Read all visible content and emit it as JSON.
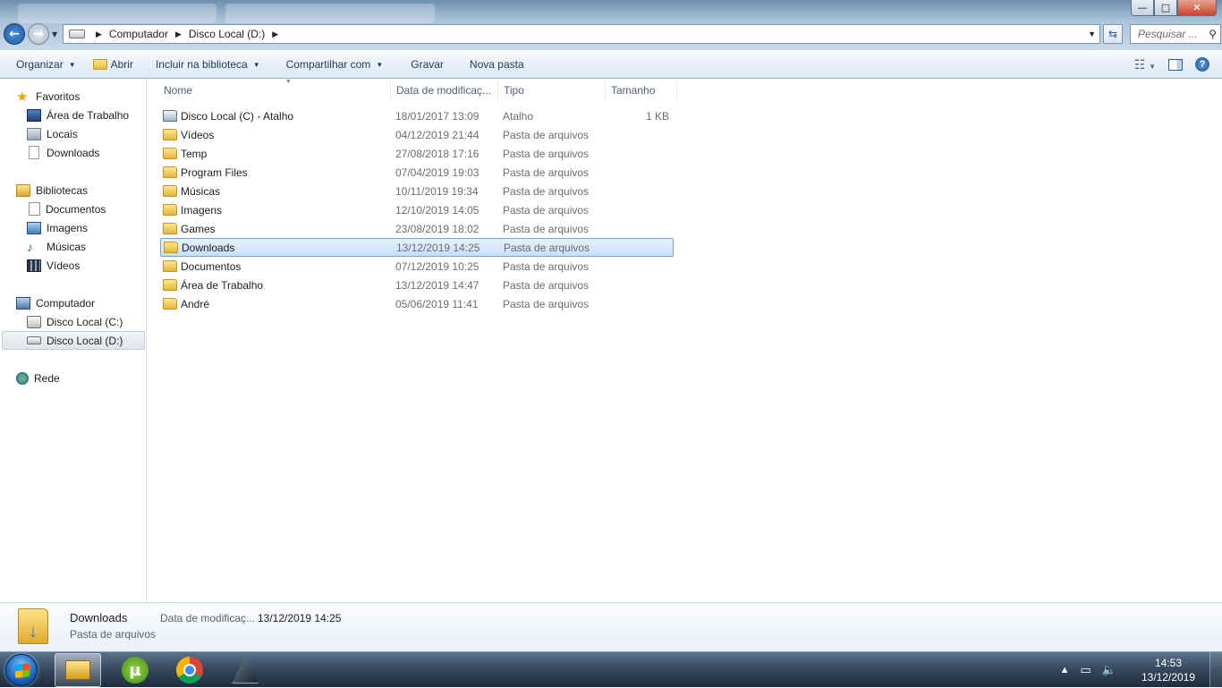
{
  "window": {
    "controls": {
      "minimize": "—",
      "maximize": "□",
      "close": "✕"
    }
  },
  "address": {
    "segments": [
      "Computador",
      "Disco Local (D:)"
    ],
    "search_placeholder": "Pesquisar ..."
  },
  "toolbar": {
    "organize": "Organizar",
    "open": "Abrir",
    "include_library": "Incluir na biblioteca",
    "share": "Compartilhar com",
    "burn": "Gravar",
    "new_folder": "Nova pasta"
  },
  "navpane": {
    "favorites": {
      "label": "Favoritos",
      "items": [
        "Área de Trabalho",
        "Locais",
        "Downloads"
      ]
    },
    "libraries": {
      "label": "Bibliotecas",
      "items": [
        "Documentos",
        "Imagens",
        "Músicas",
        "Vídeos"
      ]
    },
    "computer": {
      "label": "Computador",
      "items": [
        "Disco Local (C:)",
        "Disco Local (D:)"
      ]
    },
    "network": {
      "label": "Rede"
    }
  },
  "columns": [
    "Nome",
    "Data de modificaç...",
    "Tipo",
    "Tamanho"
  ],
  "files": [
    {
      "name": "Disco Local (C) - Atalho",
      "date": "18/01/2017 13:09",
      "type": "Atalho",
      "size": "1 KB"
    },
    {
      "name": "Vídeos",
      "date": "04/12/2019 21:44",
      "type": "Pasta de arquivos",
      "size": ""
    },
    {
      "name": "Temp",
      "date": "27/08/2018 17:16",
      "type": "Pasta de arquivos",
      "size": ""
    },
    {
      "name": "Program Files",
      "date": "07/04/2019 19:03",
      "type": "Pasta de arquivos",
      "size": ""
    },
    {
      "name": "Músicas",
      "date": "10/11/2019 19:34",
      "type": "Pasta de arquivos",
      "size": ""
    },
    {
      "name": "Imagens",
      "date": "12/10/2019 14:05",
      "type": "Pasta de arquivos",
      "size": ""
    },
    {
      "name": "Games",
      "date": "23/08/2019 18:02",
      "type": "Pasta de arquivos",
      "size": ""
    },
    {
      "name": "Downloads",
      "date": "13/12/2019 14:25",
      "type": "Pasta de arquivos",
      "size": ""
    },
    {
      "name": "Documentos",
      "date": "07/12/2019 10:25",
      "type": "Pasta de arquivos",
      "size": ""
    },
    {
      "name": "Área de Trabalho",
      "date": "13/12/2019 14:47",
      "type": "Pasta de arquivos",
      "size": ""
    },
    {
      "name": "André",
      "date": "05/06/2019 11:41",
      "type": "Pasta de arquivos",
      "size": ""
    }
  ],
  "details": {
    "name": "Downloads",
    "type": "Pasta de arquivos",
    "date_label": "Data de modificaç...",
    "date_value": "13/12/2019 14:25"
  },
  "taskbar": {
    "clock_time": "14:53",
    "clock_date": "13/12/2019",
    "apps": [
      "explorer-icon",
      "utorrent-icon",
      "chrome-icon",
      "game-icon"
    ]
  },
  "colors": {
    "accent": "#1e395b",
    "selection": "#c4e0fb",
    "folder": "#e5b53b"
  }
}
